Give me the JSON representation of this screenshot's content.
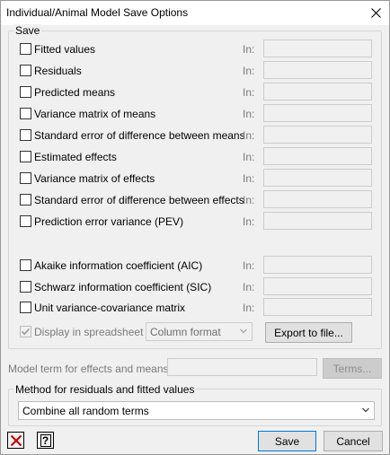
{
  "window": {
    "title": "Individual/Animal Model Save Options"
  },
  "save_group": {
    "legend": "Save",
    "in_label": "In:",
    "options": [
      {
        "label": "Fitted values",
        "checked": false
      },
      {
        "label": "Residuals",
        "checked": false
      },
      {
        "label": "Predicted means",
        "checked": false
      },
      {
        "label": "Variance matrix of means",
        "checked": false
      },
      {
        "label": "Standard error of difference between means",
        "checked": false
      },
      {
        "label": "Estimated effects",
        "checked": false
      },
      {
        "label": "Variance matrix of effects",
        "checked": false
      },
      {
        "label": "Standard error of difference between effects",
        "checked": false
      },
      {
        "label": "Prediction error variance (PEV)",
        "checked": false
      },
      {
        "label": "Akaike information coefficient (AIC)",
        "checked": false
      },
      {
        "label": "Schwarz information coefficient (SIC)",
        "checked": false
      },
      {
        "label": "Unit variance-covariance matrix",
        "checked": false
      }
    ],
    "display_label": "Display in spreadsheet in:",
    "display_checked": true,
    "display_format": "Column format",
    "export_label": "Export to file..."
  },
  "model_term": {
    "label": "Model term for effects and means:",
    "value": "",
    "terms_label": "Terms..."
  },
  "method_group": {
    "legend": "Method for residuals and fitted values",
    "selected": "Combine all random terms"
  },
  "footer": {
    "save_label": "Save",
    "cancel_label": "Cancel"
  }
}
